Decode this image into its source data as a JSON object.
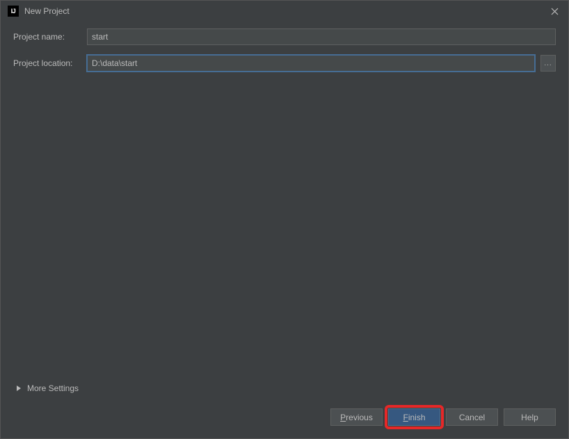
{
  "titlebar": {
    "title": "New Project"
  },
  "form": {
    "project_name_label": "Project name:",
    "project_name_value": "start",
    "project_location_label": "Project location:",
    "project_location_value": "D:\\data\\start",
    "browse_label": "..."
  },
  "more_settings": {
    "label": "More Settings"
  },
  "buttons": {
    "previous": "Previous",
    "previous_mnemonic": "P",
    "previous_rest": "revious",
    "finish": "Finish",
    "finish_mnemonic": "F",
    "finish_rest": "inish",
    "cancel": "Cancel",
    "help": "Help"
  }
}
